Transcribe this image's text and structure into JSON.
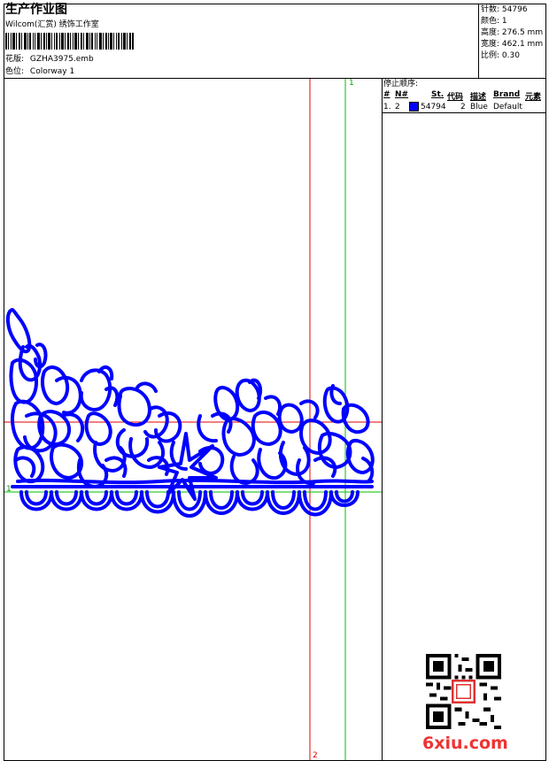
{
  "header": {
    "title": "生产作业图",
    "subtitle": "Wilcom(汇赏) 绣饰工作室",
    "pattern_label": "花版:",
    "pattern_value": "GZHA3975.emb",
    "colorway_label": "色位:",
    "colorway_value": "Colorway 1"
  },
  "stats": [
    {
      "label": "针数:",
      "value": "54796"
    },
    {
      "label": "颜色:",
      "value": "1"
    },
    {
      "label": "高度:",
      "value": "276.5 mm"
    },
    {
      "label": "宽度:",
      "value": "462.1 mm"
    },
    {
      "label": "比例:",
      "value": "0.30"
    }
  ],
  "stop_sequence": {
    "title": "停止顺序:",
    "columns": [
      "#",
      "N#",
      "St.",
      "代码",
      "描述",
      "Brand",
      "元素"
    ],
    "rows": [
      {
        "index": "1.",
        "needle": "2",
        "swatch_color": "#0000ff",
        "stitches": "54794",
        "code": "2",
        "description": "Blue",
        "brand": "Default",
        "element": ""
      }
    ]
  },
  "guides": {
    "vertical_guide_1_label": "1",
    "vertical_guide_2_label": "2",
    "horizontal_guide_1_label": "1",
    "red_color": "#e00000",
    "green_color": "#00c000"
  },
  "design": {
    "thread_color": "#0000ff",
    "description": ""
  },
  "watermark": {
    "site": "6xiu.com",
    "color": "#e33333"
  }
}
